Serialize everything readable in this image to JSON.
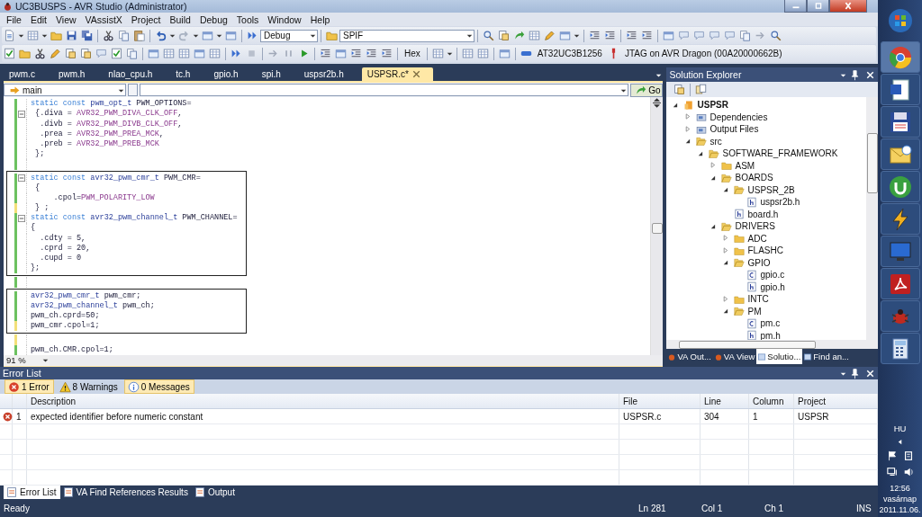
{
  "window": {
    "title": "UC3BUSPS - AVR Studio (Administrator)"
  },
  "menu": [
    "File",
    "Edit",
    "View",
    "VAssistX",
    "Project",
    "Build",
    "Debug",
    "Tools",
    "Window",
    "Help"
  ],
  "toolbar": {
    "configuration": "Debug",
    "project": "SPIF",
    "hex_button": "Hex",
    "device": "AT32UC3B1256",
    "tool": "JTAG on AVR Dragon (00A20000662B)"
  },
  "document_tabs": [
    {
      "label": "pwm.c",
      "selected": false
    },
    {
      "label": "pwm.h",
      "selected": false
    },
    {
      "label": "nlao_cpu.h",
      "selected": false
    },
    {
      "label": "tc.h",
      "selected": false
    },
    {
      "label": "gpio.h",
      "selected": false
    },
    {
      "label": "spi.h",
      "selected": false
    },
    {
      "label": "uspsr2b.h",
      "selected": false
    },
    {
      "label": "USPSR.c*",
      "selected": true
    }
  ],
  "editor": {
    "function_dropdown": "main",
    "go_button": "Go",
    "zoom": "91 %",
    "blocks": [
      {
        "framed": false,
        "lines": [
          {
            "unsaved": false,
            "fold": false,
            "tokens": [
              {
                "text": "static ",
                "kind": "keyword"
              },
              {
                "text": "const ",
                "kind": "keyword"
              },
              {
                "text": "pwm_opt_t ",
                "kind": "type"
              },
              {
                "text": "PWM_OPTIONS=",
                "kind": "plain"
              }
            ]
          },
          {
            "unsaved": false,
            "fold": true,
            "tokens": [
              {
                "text": " {.diva = ",
                "kind": "plain"
              },
              {
                "text": "AVR32_PWM_DIVA_CLK_OFF",
                "kind": "macro"
              },
              {
                "text": ",",
                "kind": "plain"
              }
            ]
          },
          {
            "unsaved": false,
            "fold": false,
            "tokens": [
              {
                "text": "  .divb = ",
                "kind": "plain"
              },
              {
                "text": "AVR32_PWM_DIVB_CLK_OFF",
                "kind": "macro"
              },
              {
                "text": ",",
                "kind": "plain"
              }
            ]
          },
          {
            "unsaved": false,
            "fold": false,
            "tokens": [
              {
                "text": "  .prea = ",
                "kind": "plain"
              },
              {
                "text": "AVR32_PWM_PREA_MCK",
                "kind": "macro"
              },
              {
                "text": ",",
                "kind": "plain"
              }
            ]
          },
          {
            "unsaved": false,
            "fold": false,
            "tokens": [
              {
                "text": "  .preb = ",
                "kind": "plain"
              },
              {
                "text": "AVR32_PWM_PREB_MCK",
                "kind": "macro"
              }
            ]
          },
          {
            "unsaved": false,
            "fold": false,
            "tokens": [
              {
                "text": " };",
                "kind": "plain"
              }
            ]
          },
          {
            "unsaved": false,
            "fold": false
          }
        ]
      },
      {
        "framed": true,
        "lines": [
          {
            "unsaved": false,
            "fold": true,
            "tokens": [
              {
                "text": "static ",
                "kind": "keyword"
              },
              {
                "text": "const ",
                "kind": "keyword"
              },
              {
                "text": "avr32_pwm_cmr_t ",
                "kind": "type"
              },
              {
                "text": "PWM_CMR=",
                "kind": "plain"
              }
            ]
          },
          {
            "unsaved": false,
            "fold": false,
            "tokens": [
              {
                "text": " {",
                "kind": "plain"
              }
            ]
          },
          {
            "unsaved": false,
            "fold": false,
            "tokens": [
              {
                "text": "     .cpol=",
                "kind": "plain"
              },
              {
                "text": "PWM_POLARITY_LOW",
                "kind": "macro"
              }
            ]
          },
          {
            "unsaved": true,
            "fold": false,
            "tokens": [
              {
                "text": " } ;",
                "kind": "plain"
              }
            ]
          },
          {
            "unsaved": false,
            "fold": true,
            "tokens": [
              {
                "text": "static ",
                "kind": "keyword"
              },
              {
                "text": "const ",
                "kind": "keyword"
              },
              {
                "text": "avr32_pwm_channel_t ",
                "kind": "type"
              },
              {
                "text": "PWM_CHANNEL=",
                "kind": "plain"
              }
            ]
          },
          {
            "unsaved": false,
            "fold": false,
            "tokens": [
              {
                "text": "{",
                "kind": "plain"
              }
            ]
          },
          {
            "unsaved": false,
            "fold": false,
            "tokens": [
              {
                "text": "  .cdty = 5,",
                "kind": "plain"
              }
            ]
          },
          {
            "unsaved": false,
            "fold": false,
            "tokens": [
              {
                "text": "  .cprd = 20,",
                "kind": "plain"
              }
            ]
          },
          {
            "unsaved": false,
            "fold": false,
            "tokens": [
              {
                "text": "  .cupd = 0",
                "kind": "plain"
              }
            ]
          },
          {
            "unsaved": false,
            "fold": false,
            "tokens": [
              {
                "text": "};",
                "kind": "plain"
              }
            ]
          }
        ]
      },
      {
        "framed": false,
        "lines": [
          {
            "unsaved": false,
            "fold": false
          }
        ]
      },
      {
        "framed": true,
        "lines": [
          {
            "unsaved": false,
            "fold": false,
            "tokens": [
              {
                "text": "avr32_pwm_cmr_t ",
                "kind": "type"
              },
              {
                "text": "pwm_cmr;",
                "kind": "plain"
              }
            ]
          },
          {
            "unsaved": false,
            "fold": false,
            "tokens": [
              {
                "text": "avr32_pwm_channel_t ",
                "kind": "type"
              },
              {
                "text": "pwm_ch;",
                "kind": "plain"
              }
            ]
          },
          {
            "unsaved": false,
            "fold": false,
            "tokens": [
              {
                "text": "pwm_ch.cprd=50;",
                "kind": "plain"
              }
            ]
          },
          {
            "unsaved": true,
            "fold": false,
            "tokens": [
              {
                "text": "pwm_cmr.cpol=1;",
                "kind": "plain"
              }
            ]
          }
        ]
      },
      {
        "framed": false,
        "lines": [
          {
            "unsaved": true,
            "fold": false
          },
          {
            "unsaved": false,
            "fold": false,
            "tokens": [
              {
                "text": "pwm_ch.CMR.cpol=1;",
                "kind": "plain"
              }
            ]
          }
        ]
      }
    ]
  },
  "solution_explorer": {
    "title": "Solution Explorer",
    "tree": [
      {
        "label": "USPSR",
        "kind": "project",
        "expanded": true,
        "children": [
          {
            "label": "Dependencies",
            "kind": "reference",
            "expanded": false
          },
          {
            "label": "Output Files",
            "kind": "reference",
            "expanded": false
          },
          {
            "label": "src",
            "kind": "folder",
            "expanded": true,
            "children": [
              {
                "label": "SOFTWARE_FRAMEWORK",
                "kind": "folder",
                "expanded": true,
                "children": [
                  {
                    "label": "ASM",
                    "kind": "folder",
                    "expanded": false
                  },
                  {
                    "label": "BOARDS",
                    "kind": "folder",
                    "expanded": true,
                    "children": [
                      {
                        "label": "USPSR_2B",
                        "kind": "folder",
                        "expanded": true,
                        "children": [
                          {
                            "label": "uspsr2b.h",
                            "kind": "header"
                          }
                        ]
                      },
                      {
                        "label": "board.h",
                        "kind": "header"
                      }
                    ]
                  },
                  {
                    "label": "DRIVERS",
                    "kind": "folder",
                    "expanded": true,
                    "children": [
                      {
                        "label": "ADC",
                        "kind": "folder",
                        "expanded": false
                      },
                      {
                        "label": "FLASHC",
                        "kind": "folder",
                        "expanded": false
                      },
                      {
                        "label": "GPIO",
                        "kind": "folder",
                        "expanded": true,
                        "children": [
                          {
                            "label": "gpio.c",
                            "kind": "source"
                          },
                          {
                            "label": "gpio.h",
                            "kind": "header"
                          }
                        ]
                      },
                      {
                        "label": "INTC",
                        "kind": "folder",
                        "expanded": false
                      },
                      {
                        "label": "PM",
                        "kind": "folder",
                        "expanded": true,
                        "children": [
                          {
                            "label": "pm.c",
                            "kind": "source"
                          },
                          {
                            "label": "pm.h",
                            "kind": "header"
                          }
                        ]
                      }
                    ]
                  }
                ]
              }
            ]
          }
        ]
      }
    ],
    "tabs": [
      {
        "label": "VA Out...",
        "selected": false
      },
      {
        "label": "VA View",
        "selected": false
      },
      {
        "label": "Solutio...",
        "selected": true
      },
      {
        "label": "Find an...",
        "selected": false
      }
    ]
  },
  "error_list": {
    "title": "Error List",
    "filters": [
      {
        "kind": "error",
        "label": "1 Error",
        "on": true
      },
      {
        "kind": "warning",
        "label": "8 Warnings",
        "on": false
      },
      {
        "kind": "message",
        "label": "0 Messages",
        "on": true
      }
    ],
    "columns": [
      "Description",
      "File",
      "Line",
      "Column",
      "Project"
    ],
    "rows": [
      {
        "kind": "error",
        "number": "1",
        "description": "expected identifier before numeric constant",
        "file": "USPSR.c",
        "line": "304",
        "column": "1",
        "project": "USPSR"
      }
    ]
  },
  "bottom_tabs": [
    {
      "label": "Error List",
      "selected": true
    },
    {
      "label": "VA Find References Results",
      "selected": false
    },
    {
      "label": "Output",
      "selected": false
    }
  ],
  "status_bar": {
    "message": "Ready",
    "line": "Ln 281",
    "column": "Col 1",
    "char": "Ch 1",
    "mode": "INS"
  },
  "taskbar": {
    "language": "HU",
    "time": "12:56",
    "day": "vasárnap",
    "date": "2011.11.06."
  }
}
